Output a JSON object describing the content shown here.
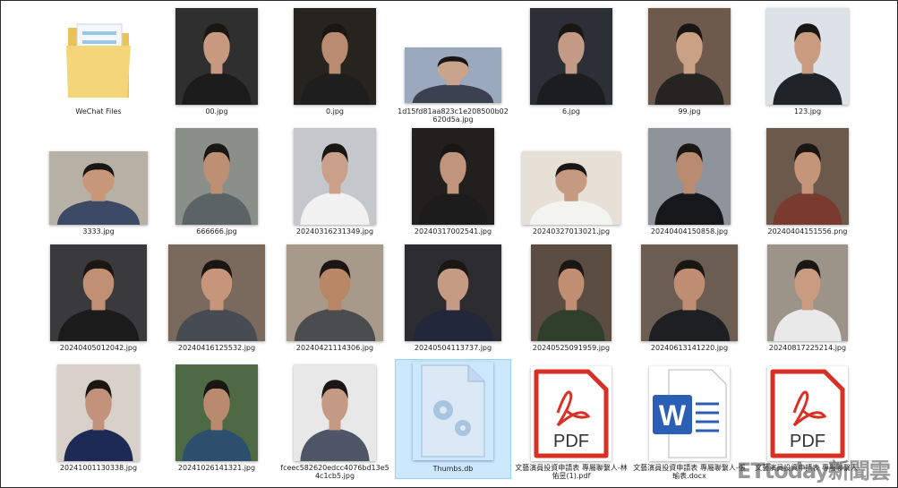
{
  "files": [
    {
      "name": "WeChat Files",
      "kind": "folder"
    },
    {
      "name": "00.jpg",
      "kind": "photo",
      "bg": "#2f2f30",
      "skin": "#c79a80",
      "shirt": "#1b1b1b"
    },
    {
      "name": "0.jpg",
      "kind": "photo",
      "bg": "#27241f",
      "skin": "#b98b70",
      "shirt": "#1e1e1e"
    },
    {
      "name": "1d15fd81aa823c1e208500b02620d5a.jpg",
      "kind": "photo",
      "bg": "#9aa9bd",
      "skin": "#c9a38b",
      "shirt": "#3b4150"
    },
    {
      "name": "6.jpg",
      "kind": "photo",
      "bg": "#2c3036",
      "skin": "#c29a86",
      "shirt": "#1c1d1f"
    },
    {
      "name": "99.jpg",
      "kind": "photo",
      "bg": "#6e5a4c",
      "skin": "#caa184",
      "shirt": "#262422"
    },
    {
      "name": "123.jpg",
      "kind": "photo",
      "bg": "#dce2e7",
      "skin": "#c99c80",
      "shirt": "#1f2226"
    },
    {
      "name": "3333.jpg",
      "kind": "photo",
      "bg": "#b7b0a5",
      "skin": "#c8977a",
      "shirt": "#3d4a66"
    },
    {
      "name": "666666.jpg",
      "kind": "photo",
      "bg": "#8b8f8a",
      "skin": "#bd8f73",
      "shirt": "#5a6466"
    },
    {
      "name": "20240316231349.jpg",
      "kind": "photo",
      "bg": "#c4c8cc",
      "skin": "#caa08a",
      "shirt": "#f1f1f1"
    },
    {
      "name": "20240317002541.jpg",
      "kind": "photo",
      "bg": "#22201f",
      "skin": "#c0957c",
      "shirt": "#1c1c1c"
    },
    {
      "name": "20240327013021.jpg",
      "kind": "photo",
      "bg": "#e6e0d6",
      "skin": "#c69a80",
      "shirt": "#f3f3f0"
    },
    {
      "name": "20240404150858.jpg",
      "kind": "photo",
      "bg": "#8f949a",
      "skin": "#b98c72",
      "shirt": "#15171a"
    },
    {
      "name": "20240404151556.png",
      "kind": "photo",
      "bg": "#6b5a4c",
      "skin": "#c59579",
      "shirt": "#7a3b2e"
    },
    {
      "name": "20240405012042.jpg",
      "kind": "photo",
      "bg": "#3a3a3c",
      "skin": "#c08f74",
      "shirt": "#1b1b1c"
    },
    {
      "name": "20240416125532.jpg",
      "kind": "photo",
      "bg": "#7a6a5e",
      "skin": "#c7957a",
      "shirt": "#474b52"
    },
    {
      "name": "20240421114306.jpg",
      "kind": "photo",
      "bg": "#a89a8b",
      "skin": "#b88866",
      "shirt": "#4a4c4e"
    },
    {
      "name": "20240504113737.jpg",
      "kind": "photo",
      "bg": "#2d2d31",
      "skin": "#c69b83",
      "shirt": "#22283a"
    },
    {
      "name": "20240525091959.jpg",
      "kind": "photo",
      "bg": "#5c4d43",
      "skin": "#c08f73",
      "shirt": "#2f3f2b"
    },
    {
      "name": "20240613141220.jpg",
      "kind": "photo",
      "bg": "#6b5d52",
      "skin": "#bf8d72",
      "shirt": "#1e1f22"
    },
    {
      "name": "20240817225214.jpg",
      "kind": "photo",
      "bg": "#9c9389",
      "skin": "#c99c82",
      "shirt": "#e9e9e9"
    },
    {
      "name": "20241001130338.jpg",
      "kind": "photo",
      "bg": "#d7d1c9",
      "skin": "#c2927a",
      "shirt": "#1d2a55"
    },
    {
      "name": "20241026141321.jpg",
      "kind": "photo",
      "bg": "#4e6a44",
      "skin": "#b98a6d",
      "shirt": "#2c4f6e"
    },
    {
      "name": "fceec582620edcc4076bd13e54c1cb5.jpg",
      "kind": "photo",
      "bg": "#e8e8e8",
      "skin": "#c49a84",
      "shirt": "#4d5566"
    },
    {
      "name": "Thumbs.db",
      "kind": "db",
      "selected": true
    },
    {
      "name": "文藝演員投資申請表 專屬聯繫人-林佑昱(1).pdf",
      "kind": "pdf"
    },
    {
      "name": "文藝演員投資申請表 專屬聯繫人-張瑜表.docx",
      "kind": "docx"
    },
    {
      "name": "文藝演員投資申請表 專屬聯繫人-",
      "kind": "pdf"
    }
  ],
  "pdf_label": "PDF",
  "word_label": "W",
  "watermark": "ETtoday新聞雲"
}
